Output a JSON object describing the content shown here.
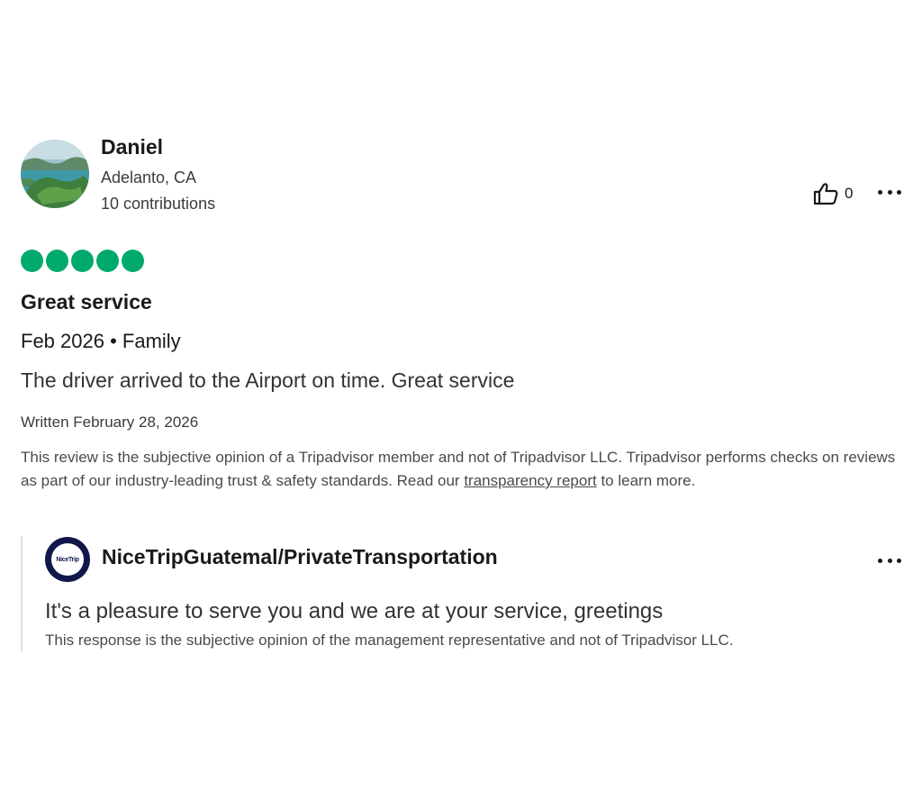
{
  "reviewer": {
    "name": "Daniel",
    "location": "Adelanto, CA",
    "contributions": "10 contributions",
    "avatar_icon": "landscape-island-avatar"
  },
  "actions": {
    "helpful_icon": "thumbs-up-icon",
    "helpful_count": "0",
    "more_icon": "more-options-icon"
  },
  "rating": {
    "value": 5,
    "max": 5,
    "color": "#00aa6c"
  },
  "review": {
    "title": "Great service",
    "trip_meta": "Feb 2026 • Family",
    "body": "The driver arrived to the Airport on time. Great service",
    "written_date": "Written February 28, 2026",
    "disclaimer_before": "This review is the subjective opinion of a Tripadvisor member and not of Tripadvisor LLC. Tripadvisor performs checks on reviews as part of our industry-leading trust & safety standards. Read our ",
    "disclaimer_link": "transparency report",
    "disclaimer_after": " to learn more."
  },
  "response": {
    "owner_name": "NiceTripGuatemal/PrivateTransportation",
    "logo_text": "NiceTrip",
    "body": "It's a pleasure to serve you and we are at your service, greetings",
    "disclaimer": "This response is the subjective opinion of the management representative and not of Tripadvisor LLC."
  }
}
